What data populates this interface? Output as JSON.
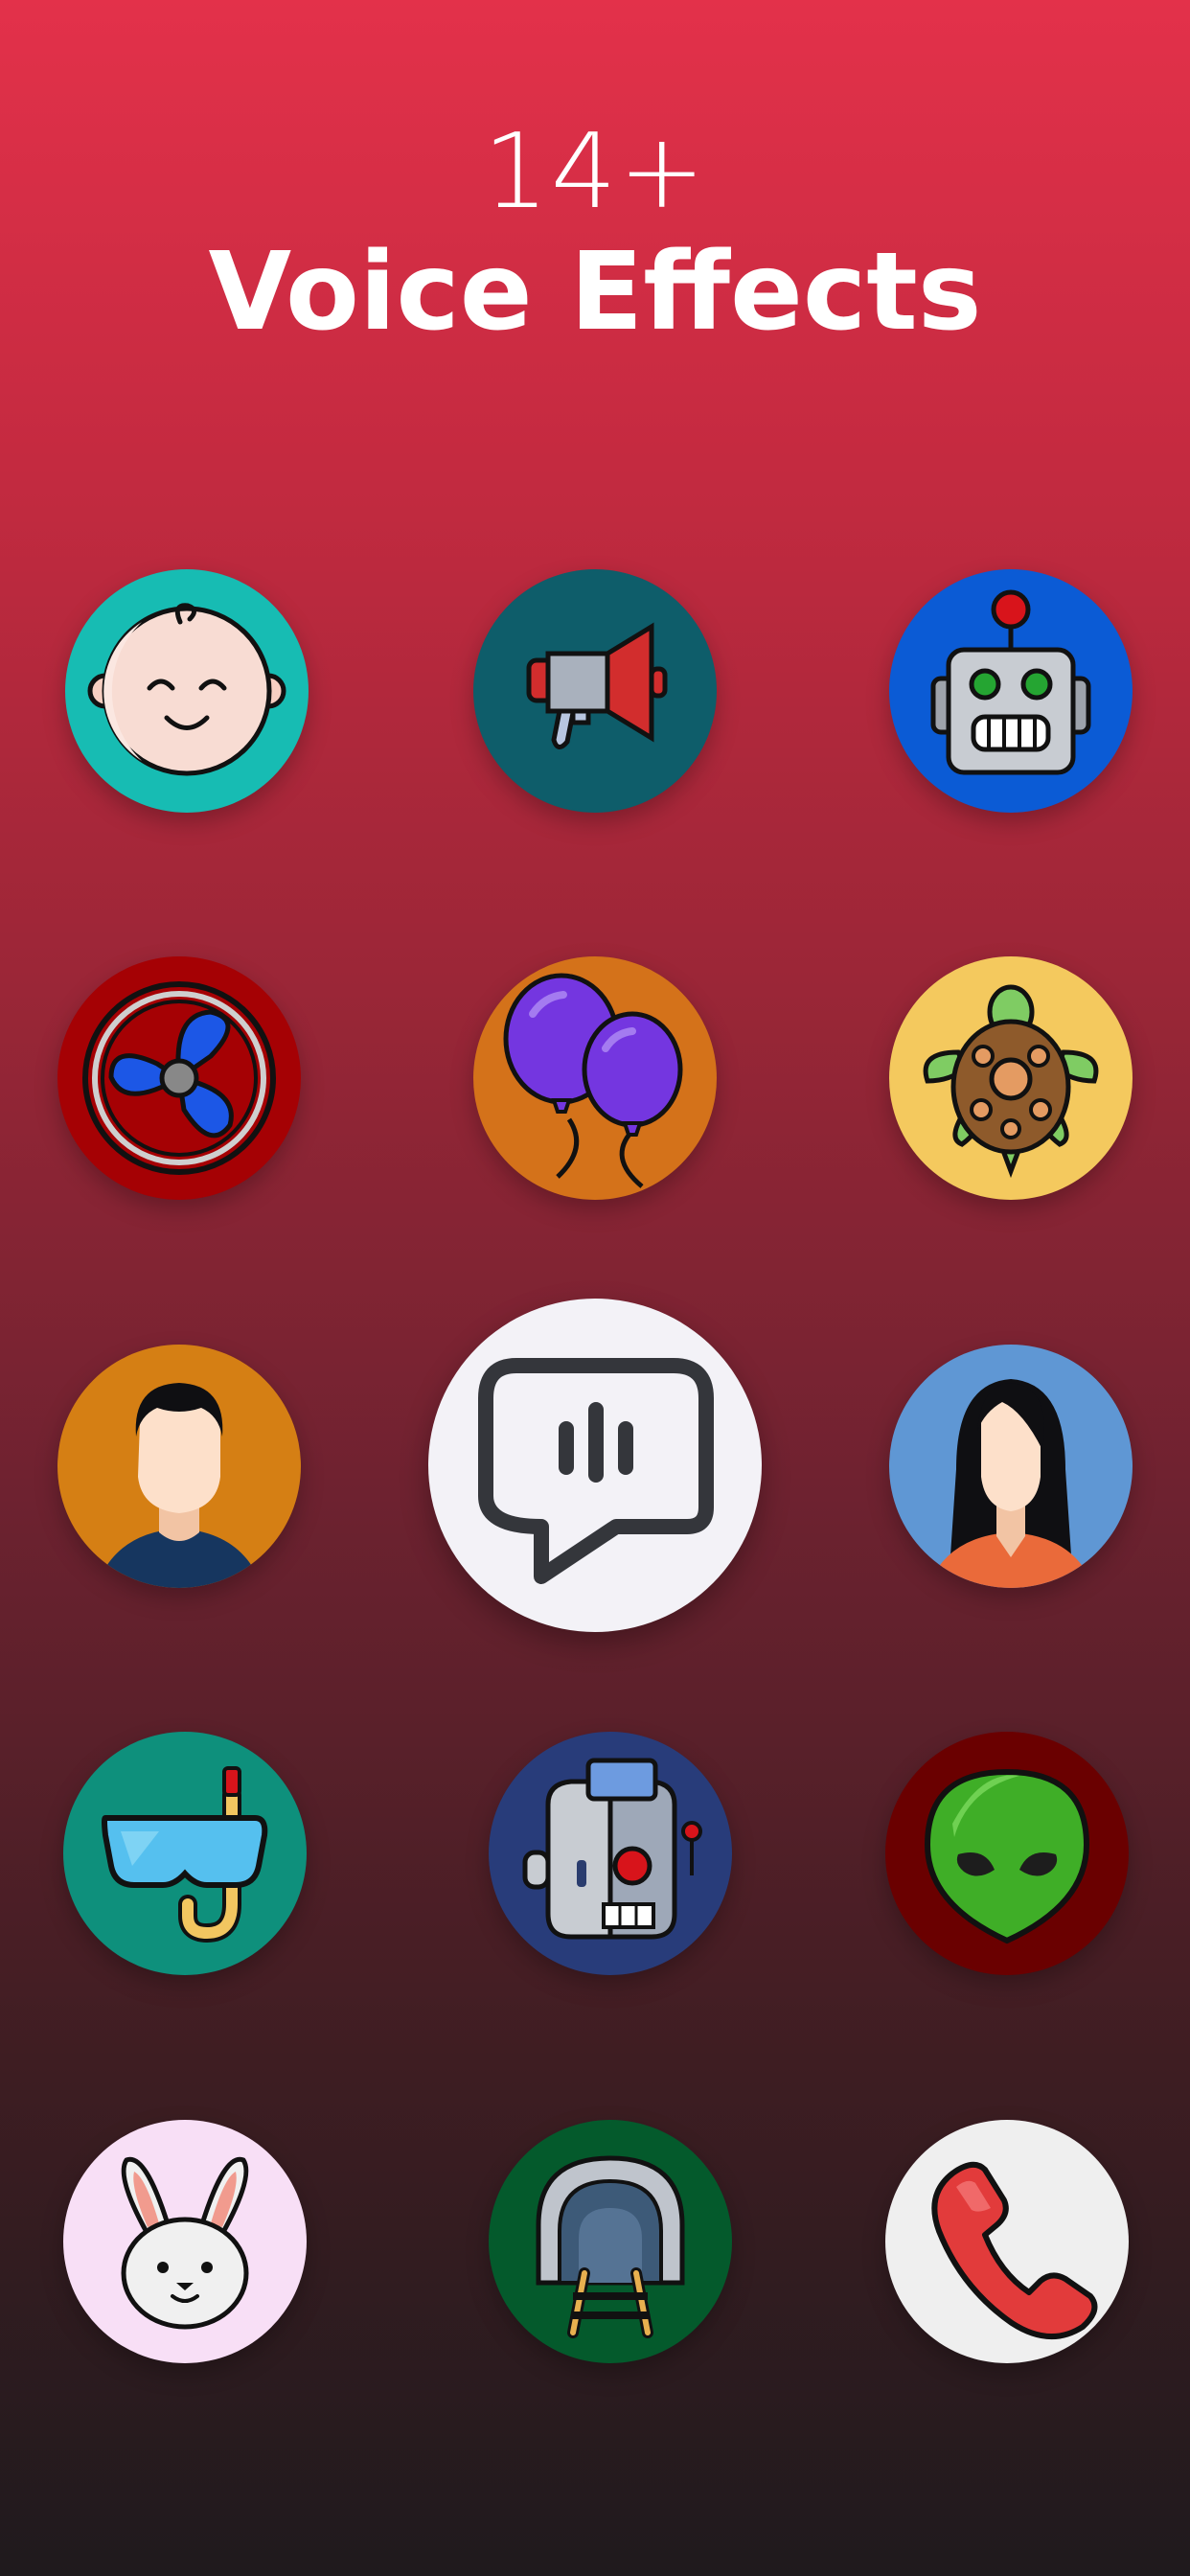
{
  "headline": {
    "count": "14+",
    "title": "Voice Effects"
  },
  "effects": [
    {
      "icon": "baby-face-icon",
      "bg": "#17bcb3"
    },
    {
      "icon": "megaphone-icon",
      "bg": "#0e5d6a"
    },
    {
      "icon": "robot-icon",
      "bg": "#0b5bd5"
    },
    {
      "icon": "fan-icon",
      "bg": "#a50104"
    },
    {
      "icon": "balloons-icon",
      "bg": "#d4721a"
    },
    {
      "icon": "turtle-icon",
      "bg": "#f4c95e"
    },
    {
      "icon": "man-avatar-icon",
      "bg": "#d57f14"
    },
    {
      "icon": "woman-avatar-icon",
      "bg": "#5f97d4"
    },
    {
      "icon": "snorkel-mask-icon",
      "bg": "#0e907c"
    },
    {
      "icon": "cyborg-icon",
      "bg": "#283c7a"
    },
    {
      "icon": "alien-icon",
      "bg": "#6a0000"
    },
    {
      "icon": "bunny-icon",
      "bg": "#f8dff6"
    },
    {
      "icon": "tunnel-icon",
      "bg": "#045a2c"
    },
    {
      "icon": "phone-icon",
      "bg": "#efefef"
    }
  ],
  "center_button": {
    "icon": "voice-message-icon",
    "bg": "#f3f2f7"
  }
}
